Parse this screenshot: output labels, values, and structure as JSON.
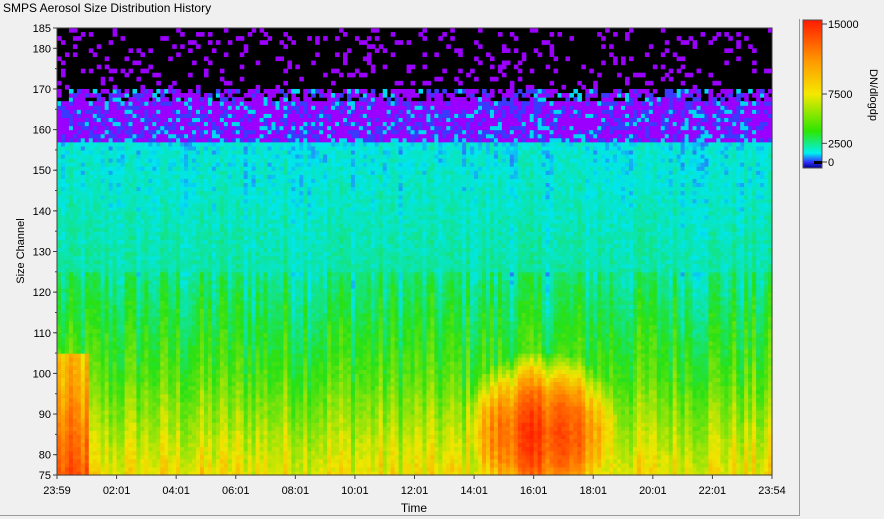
{
  "window": {
    "title": "SMPS Aerosol Size Distribution History"
  },
  "chart_data": {
    "type": "heatmap",
    "title": "SMPS Aerosol Size Distribution History",
    "xlabel": "Time",
    "ylabel": "Size Channel",
    "x_ticks": [
      "23:59",
      "02:01",
      "04:01",
      "06:01",
      "08:01",
      "10:01",
      "12:01",
      "14:01",
      "16:01",
      "18:01",
      "20:01",
      "22:01",
      "23:54"
    ],
    "y_ticks": [
      75,
      80,
      90,
      100,
      110,
      120,
      130,
      140,
      150,
      160,
      170,
      180,
      185
    ],
    "ylim": [
      75,
      185
    ],
    "colorbar": {
      "label": "DN/dlogdp",
      "ticks": [
        15000,
        7500,
        2500,
        0
      ],
      "range": [
        0,
        15000
      ]
    },
    "colors": {
      "background": "#f0f0f0",
      "no_data": "#000000",
      "low": "#8a00ff",
      "mid_low": "#00f0f0",
      "mid": "#2ee600",
      "mid_high": "#f5e800",
      "high": "#ff2a00"
    },
    "features": {
      "description_bands": [
        {
          "channels": [
            75,
            100
          ],
          "level": "medium-high"
        },
        {
          "channels": [
            100,
            125
          ],
          "level": "medium"
        },
        {
          "channels": [
            125,
            157
          ],
          "level": "low-medium"
        },
        {
          "channels": [
            157,
            170
          ],
          "level": "low"
        },
        {
          "channels": [
            170,
            185
          ],
          "level": "none"
        }
      ],
      "event": {
        "time_range": [
          "13:30",
          "18:30"
        ],
        "channels": [
          75,
          105
        ],
        "level": "high"
      }
    }
  }
}
